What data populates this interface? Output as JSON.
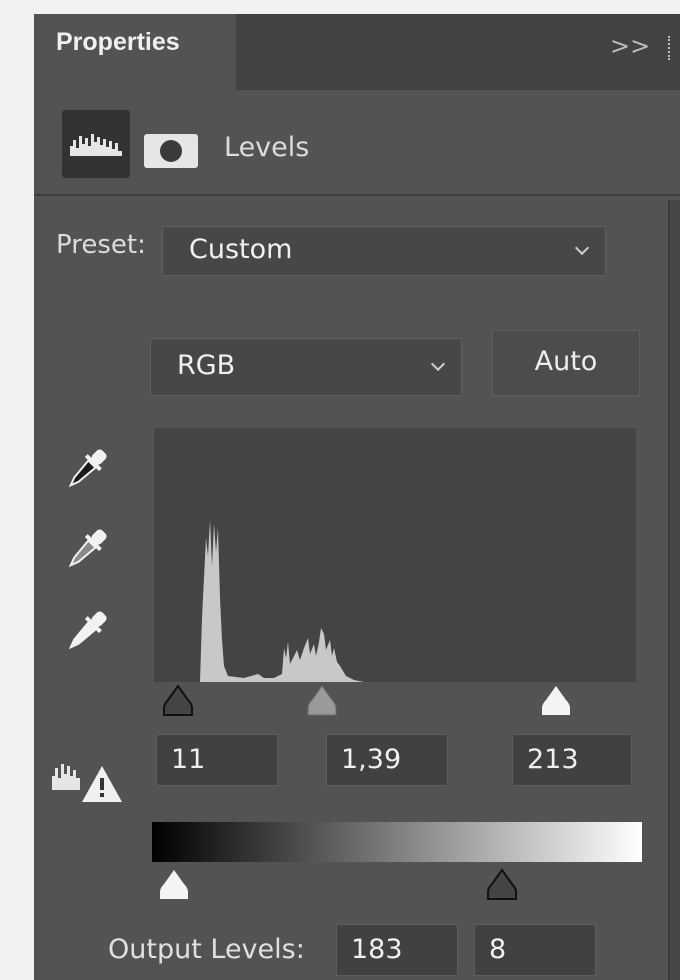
{
  "panel": {
    "tab_title": "Properties",
    "collapse_glyph": ">>",
    "adjustment_label": "Levels"
  },
  "preset": {
    "label": "Preset:",
    "value": "Custom"
  },
  "channel": {
    "value": "RGB",
    "auto_label": "Auto"
  },
  "input_levels": {
    "black": "11",
    "gamma": "1,39",
    "white": "213"
  },
  "output_levels": {
    "label": "Output Levels:",
    "black": "183",
    "white": "8"
  },
  "colors": {
    "panel_bg": "#535353",
    "tabbar_bg": "#424242",
    "field_bg": "#414141",
    "histogram_bg": "#444444",
    "histogram_fill": "#c8c8c8"
  },
  "icons": [
    "histogram-icon",
    "mask-icon",
    "eyedropper-black-icon",
    "eyedropper-gray-icon",
    "eyedropper-white-icon",
    "clipping-warning-icon",
    "chevron-down-icon"
  ]
}
